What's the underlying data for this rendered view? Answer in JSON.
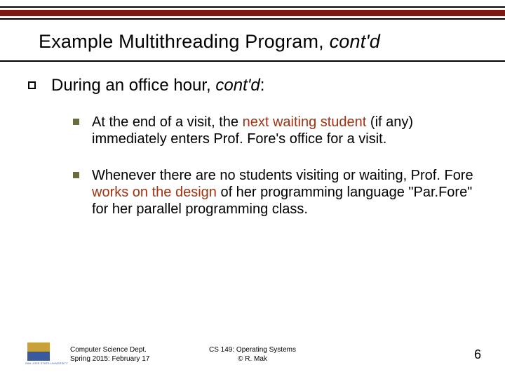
{
  "title": {
    "main": "Example Multithreading Program, ",
    "italic": "cont'd"
  },
  "body": {
    "lvl1": {
      "pre": "During an office hour",
      "post": ", ",
      "italic": "cont'd",
      "tail": ":"
    },
    "items": [
      {
        "pre": "At the end of a visit, the ",
        "hl": "next waiting student",
        "post": " (if any) immediately enters Prof. Fore's office for a visit."
      },
      {
        "pre": "Whenever there are no students visiting or waiting, Prof. Fore ",
        "hl": "works on the design",
        "post": " of her programming language \"Par.Fore\" for her parallel programming class."
      }
    ]
  },
  "footer": {
    "left_line1": "Computer Science Dept.",
    "left_line2": "Spring 2015: February 17",
    "center_line1": "CS 149: Operating Systems",
    "center_line2": "© R. Mak",
    "logo_caption": "SAN JOSE STATE UNIVERSITY",
    "page": "6"
  }
}
